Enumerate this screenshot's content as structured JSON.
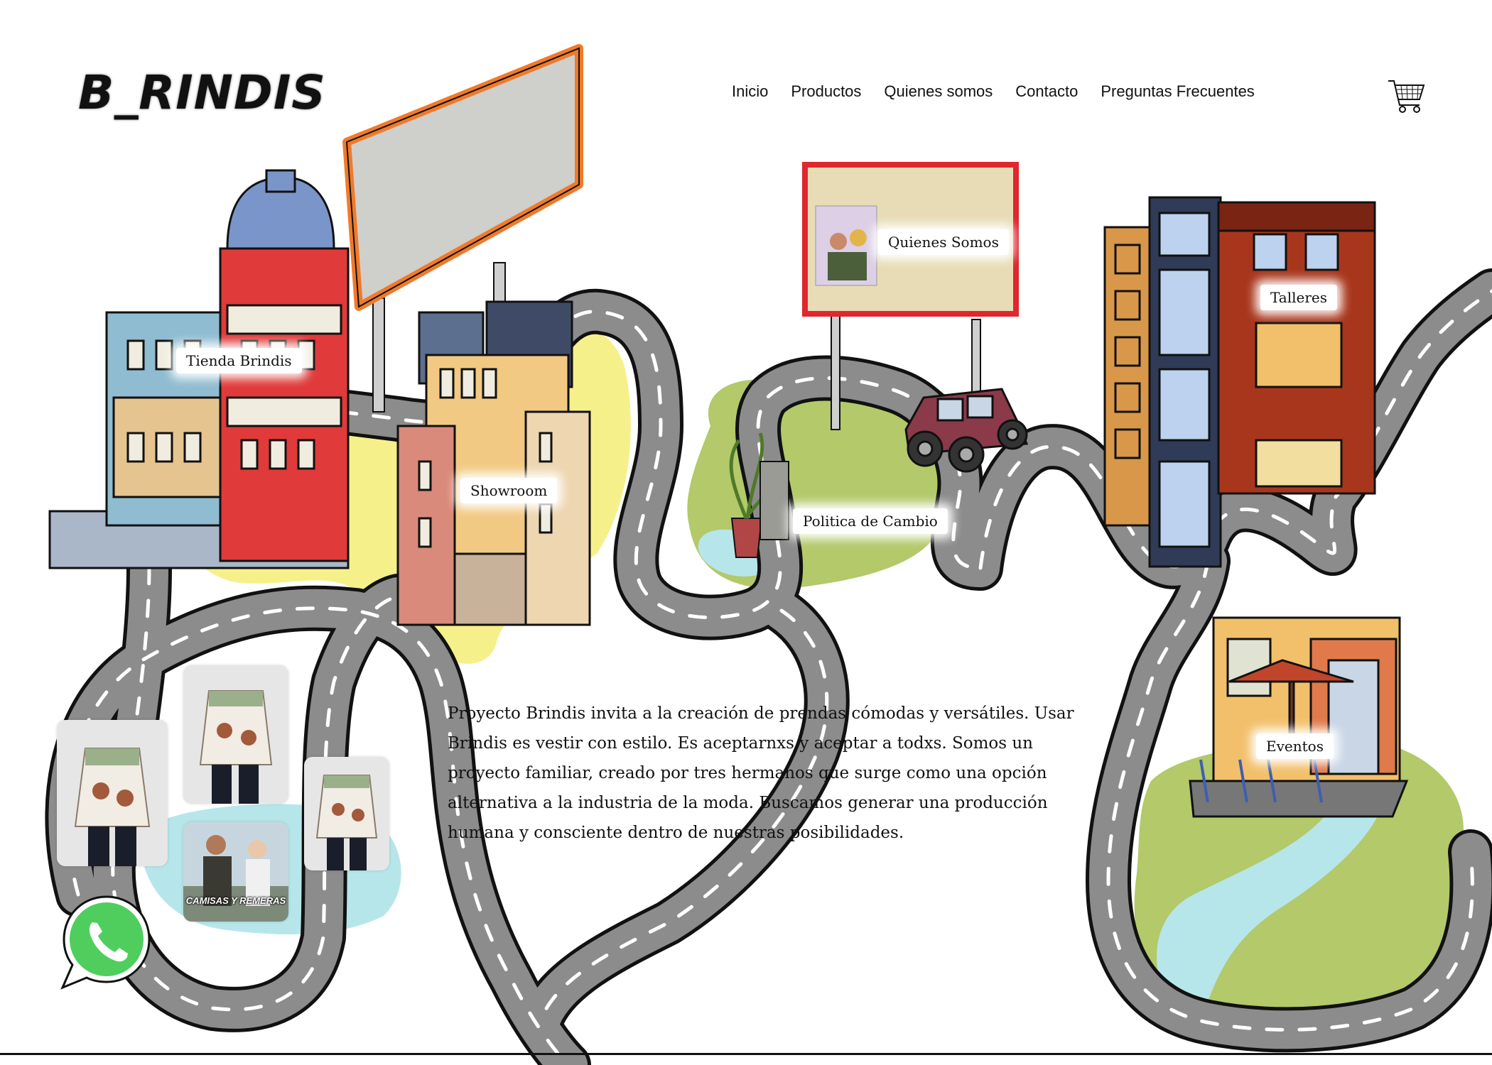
{
  "brand": {
    "logo_text": "B_RINDIS"
  },
  "nav": {
    "items": [
      {
        "label": "Inicio"
      },
      {
        "label": "Productos"
      },
      {
        "label": "Quienes somos"
      },
      {
        "label": "Contacto"
      },
      {
        "label": "Preguntas Frecuentes"
      }
    ],
    "cart_icon": "shopping-cart-icon"
  },
  "map_labels": {
    "tienda": "Tienda Brindis",
    "showroom": "Showroom",
    "quienes": "Quienes Somos",
    "politica": "Politica de Cambio",
    "talleres": "Talleres",
    "eventos": "Eventos"
  },
  "intro_lines": [
    "Proyecto Brindis invita a la creación de prendas cómodas y  versátiles. Usar",
    "Brindis es vestir con estilo. Es aceptarnxs y aceptar a todxs. Somos un",
    "proyecto familiar, creado por tres hermanos que surge como una opción",
    "alternativa a la industria de la moda. Buscamos generar una producción",
    "humana y consciente dentro de nuestras posibilidades."
  ],
  "products": {
    "caption": "CAMISAS Y REMERAS"
  },
  "contact": {
    "whatsapp_icon": "whatsapp-icon"
  },
  "colors": {
    "road": "#8c8c8c",
    "road_edge": "#111111",
    "park_green": "#b3c96a",
    "yellow_area": "#f6f08a",
    "water": "#b6e6ea",
    "billboard_orange": "#f07a2a",
    "billboard_red": "#e0262e",
    "brick": "#a8361c"
  }
}
